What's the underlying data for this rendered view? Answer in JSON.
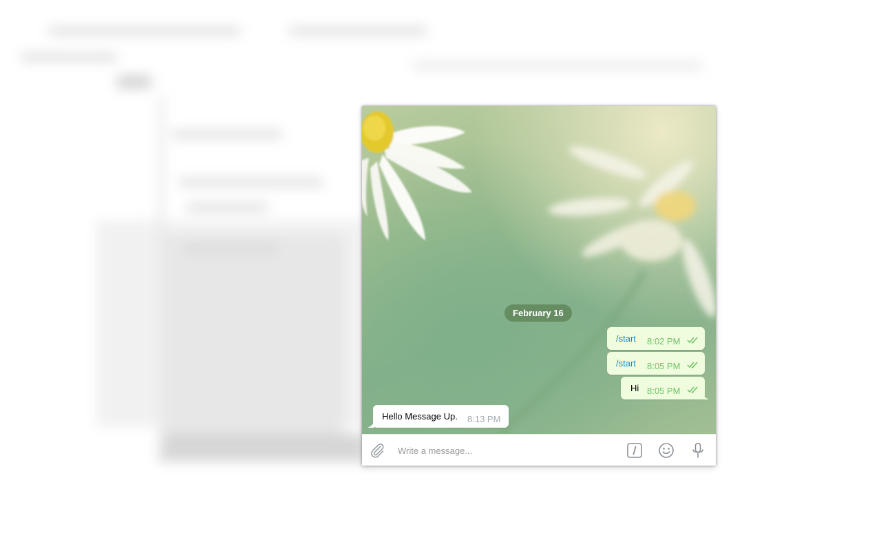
{
  "chat": {
    "date_separator": "February 16",
    "messages": [
      {
        "direction": "out",
        "text": "/start",
        "kind": "command",
        "time": "8:02 PM",
        "status": "read"
      },
      {
        "direction": "out",
        "text": "/start",
        "kind": "command",
        "time": "8:05 PM",
        "status": "read"
      },
      {
        "direction": "out",
        "text": "Hi",
        "kind": "text",
        "time": "8:05 PM",
        "status": "read"
      },
      {
        "direction": "in",
        "text": "Hello Message Up.",
        "kind": "text",
        "time": "8:13 PM"
      }
    ]
  },
  "composer": {
    "placeholder": "Write a message...",
    "icons": [
      "paperclip-icon",
      "bot-command-icon",
      "emoji-icon",
      "microphone-icon"
    ]
  },
  "colors": {
    "outgoing_bubble": "#effdde",
    "incoming_bubble": "#ffffff",
    "command_link": "#168acd",
    "outgoing_time": "#6cc264",
    "incoming_time": "#a3aab0",
    "date_pill": "#5c8052"
  }
}
